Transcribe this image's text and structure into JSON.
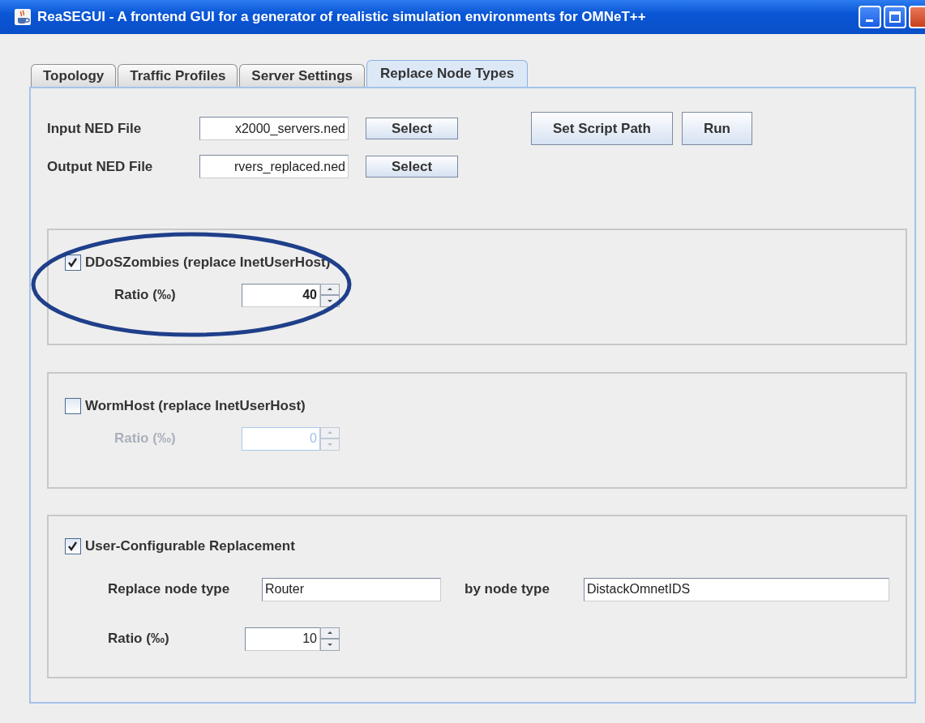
{
  "window": {
    "title": "ReaSEGUI - A frontend GUI for a generator of realistic simulation environments for OMNeT++"
  },
  "tabs": [
    {
      "label": "Topology",
      "selected": false
    },
    {
      "label": "Traffic Profiles",
      "selected": false
    },
    {
      "label": "Server Settings",
      "selected": false
    },
    {
      "label": "Replace Node Types",
      "selected": true
    }
  ],
  "files": [
    {
      "label": "Input NED File",
      "value": "x2000_servers.ned",
      "button": "Select"
    },
    {
      "label": "Output NED File",
      "value": "rvers_replaced.ned",
      "button": "Select"
    }
  ],
  "actions": [
    "Set Script Path",
    "Run"
  ],
  "groups": [
    {
      "kind": "ratio",
      "label": "DDoSZombies (replace InetUserHost)",
      "checked": true,
      "highlighted": true,
      "ratio_label": "Ratio (‰)",
      "ratio": "40",
      "disabled": false
    },
    {
      "kind": "ratio",
      "label": "WormHost (replace InetUserHost)",
      "checked": false,
      "highlighted": false,
      "ratio_label": "Ratio (‰)",
      "ratio": "0",
      "disabled": true
    },
    {
      "kind": "custom",
      "label": "User-Configurable Replacement",
      "checked": true,
      "highlighted": false,
      "replace_label": "Replace node type",
      "replace_value": "Router",
      "by_label": "by node type",
      "by_value": "DistackOmnetIDS",
      "ratio_label": "Ratio (‰)",
      "ratio": "10",
      "disabled": false
    }
  ]
}
